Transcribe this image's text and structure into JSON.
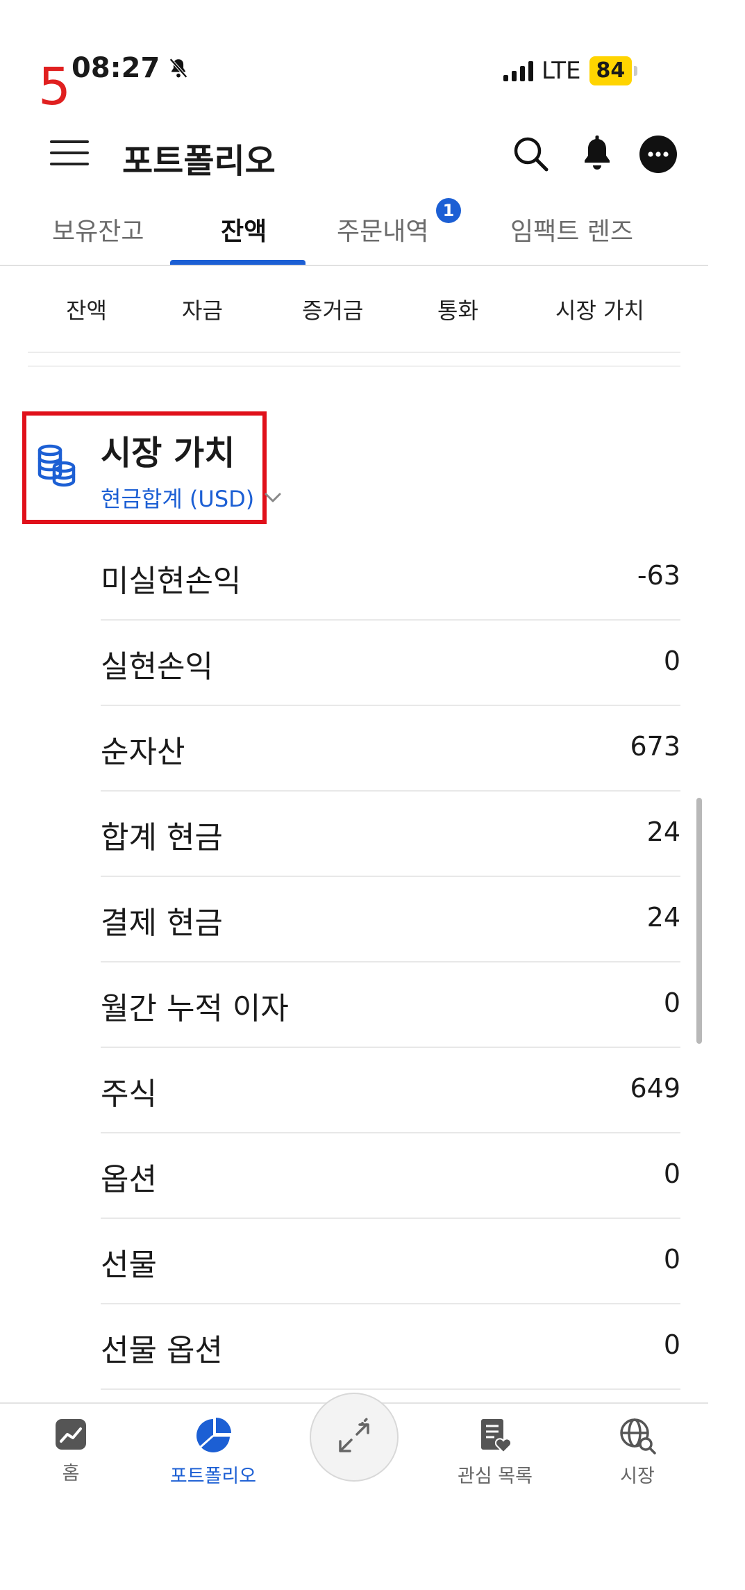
{
  "annotation_number": "5",
  "status_bar": {
    "time": "08:27",
    "network": "LTE",
    "battery": "84"
  },
  "header": {
    "title": "포트폴리오"
  },
  "tabs": [
    {
      "label": "보유잔고",
      "active": false
    },
    {
      "label": "잔액",
      "active": true
    },
    {
      "label": "주문내역",
      "active": false,
      "badge": "1"
    },
    {
      "label": "임팩트 렌즈",
      "active": false
    }
  ],
  "subtabs": [
    "잔액",
    "자금",
    "증거금",
    "통화",
    "시장 가치"
  ],
  "section": {
    "title": "시장 가치",
    "currency": "현금합계 (USD)"
  },
  "rows": [
    {
      "label": "미실현손익",
      "value": "-63"
    },
    {
      "label": "실현손익",
      "value": "0"
    },
    {
      "label": "순자산",
      "value": "673"
    },
    {
      "label": "합계 현금",
      "value": "24"
    },
    {
      "label": "결제 현금",
      "value": "24"
    },
    {
      "label": "월간 누적 이자",
      "value": "0"
    },
    {
      "label": "주식",
      "value": "649"
    },
    {
      "label": "옵션",
      "value": "0"
    },
    {
      "label": "선물",
      "value": "0"
    },
    {
      "label": "선물 옵션",
      "value": "0"
    }
  ],
  "bottom_nav": [
    {
      "label": "홈",
      "icon": "home-chart-icon",
      "active": false
    },
    {
      "label": "포트폴리오",
      "icon": "pie-chart-icon",
      "active": true
    },
    {
      "label": "관심 목록",
      "icon": "watchlist-icon",
      "active": false
    },
    {
      "label": "시장",
      "icon": "globe-search-icon",
      "active": false
    }
  ],
  "colors": {
    "accent": "#1c5fd4",
    "highlight": "#e0101a",
    "battery": "#ffd400"
  }
}
